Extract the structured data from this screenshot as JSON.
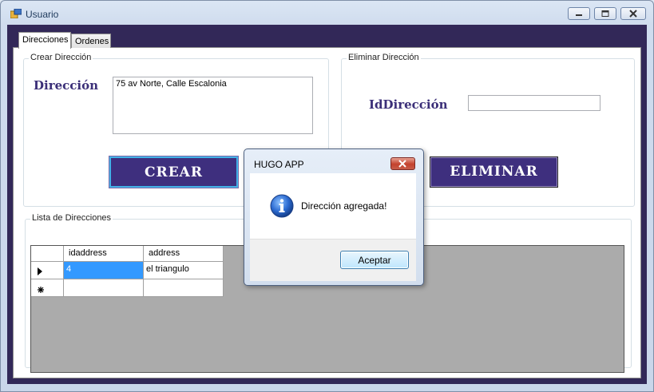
{
  "window": {
    "title": "Usuario",
    "icon": "form-app-icon",
    "controls": [
      "minimize-icon",
      "maximize-icon",
      "close-icon"
    ]
  },
  "tabs": [
    {
      "label": "Direcciones",
      "active": true
    },
    {
      "label": "Ordenes",
      "active": false
    }
  ],
  "crear_group": {
    "title": "Crear Dirección",
    "label": "Dirección",
    "value": "75 av Norte, Calle Escalonia",
    "button": "CREAR"
  },
  "eliminar_group": {
    "title": "Eliminar Dirección",
    "label": "IdDirección",
    "value": "",
    "button": "ELIMINAR"
  },
  "lista_group": {
    "title": "Lista de Direcciones",
    "columns": [
      "idaddress",
      "address"
    ],
    "rows": [
      {
        "idaddress": "4",
        "address": "el triangulo",
        "selected": true
      }
    ],
    "new_row": {
      "idaddress": "",
      "address": ""
    }
  },
  "dialog": {
    "title": "HUGO APP",
    "icon": "info-icon",
    "message": "Dirección agregada!",
    "button": "Aceptar"
  },
  "colors": {
    "frame": "#322858",
    "button_bg": "#3e2f7e",
    "label_color": "#3b2f78",
    "selection": "#3399ff",
    "grid_bg": "#ababab"
  }
}
